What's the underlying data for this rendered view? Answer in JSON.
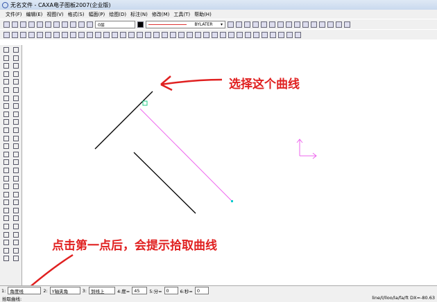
{
  "window": {
    "title": "无名文件 - CAXA电子图板2007(企业版)"
  },
  "menu": [
    "文件(F)",
    "编辑(E)",
    "视图(V)",
    "格式(S)",
    "幅面(P)",
    "绘图(D)",
    "标注(N)",
    "修改(M)",
    "工具(T)",
    "帮助(H)"
  ],
  "toolbar": {
    "layer": "0层",
    "linetype": "BYLATER"
  },
  "annotations": {
    "top": "选择这个曲线",
    "bottom": "点击第一点后，会提示拾取曲线"
  },
  "command": {
    "f1_label": "1:",
    "f1": "角度线",
    "f2_label": "2:",
    "f2": "Y轴夹角",
    "f3_label": "3:",
    "f3": "到线上",
    "f4_label": "4:度=",
    "f4": "45",
    "f5_label": "5:分=",
    "f5": "0",
    "f6_label": "6:秒=",
    "f6": "0"
  },
  "status": {
    "prompt": "拾取曲线:",
    "right": "line/l/lloo/la/fa/ft DX=-80.63"
  },
  "colors": {
    "annotation": "#e02020",
    "selected_line": "#ee66ee"
  }
}
